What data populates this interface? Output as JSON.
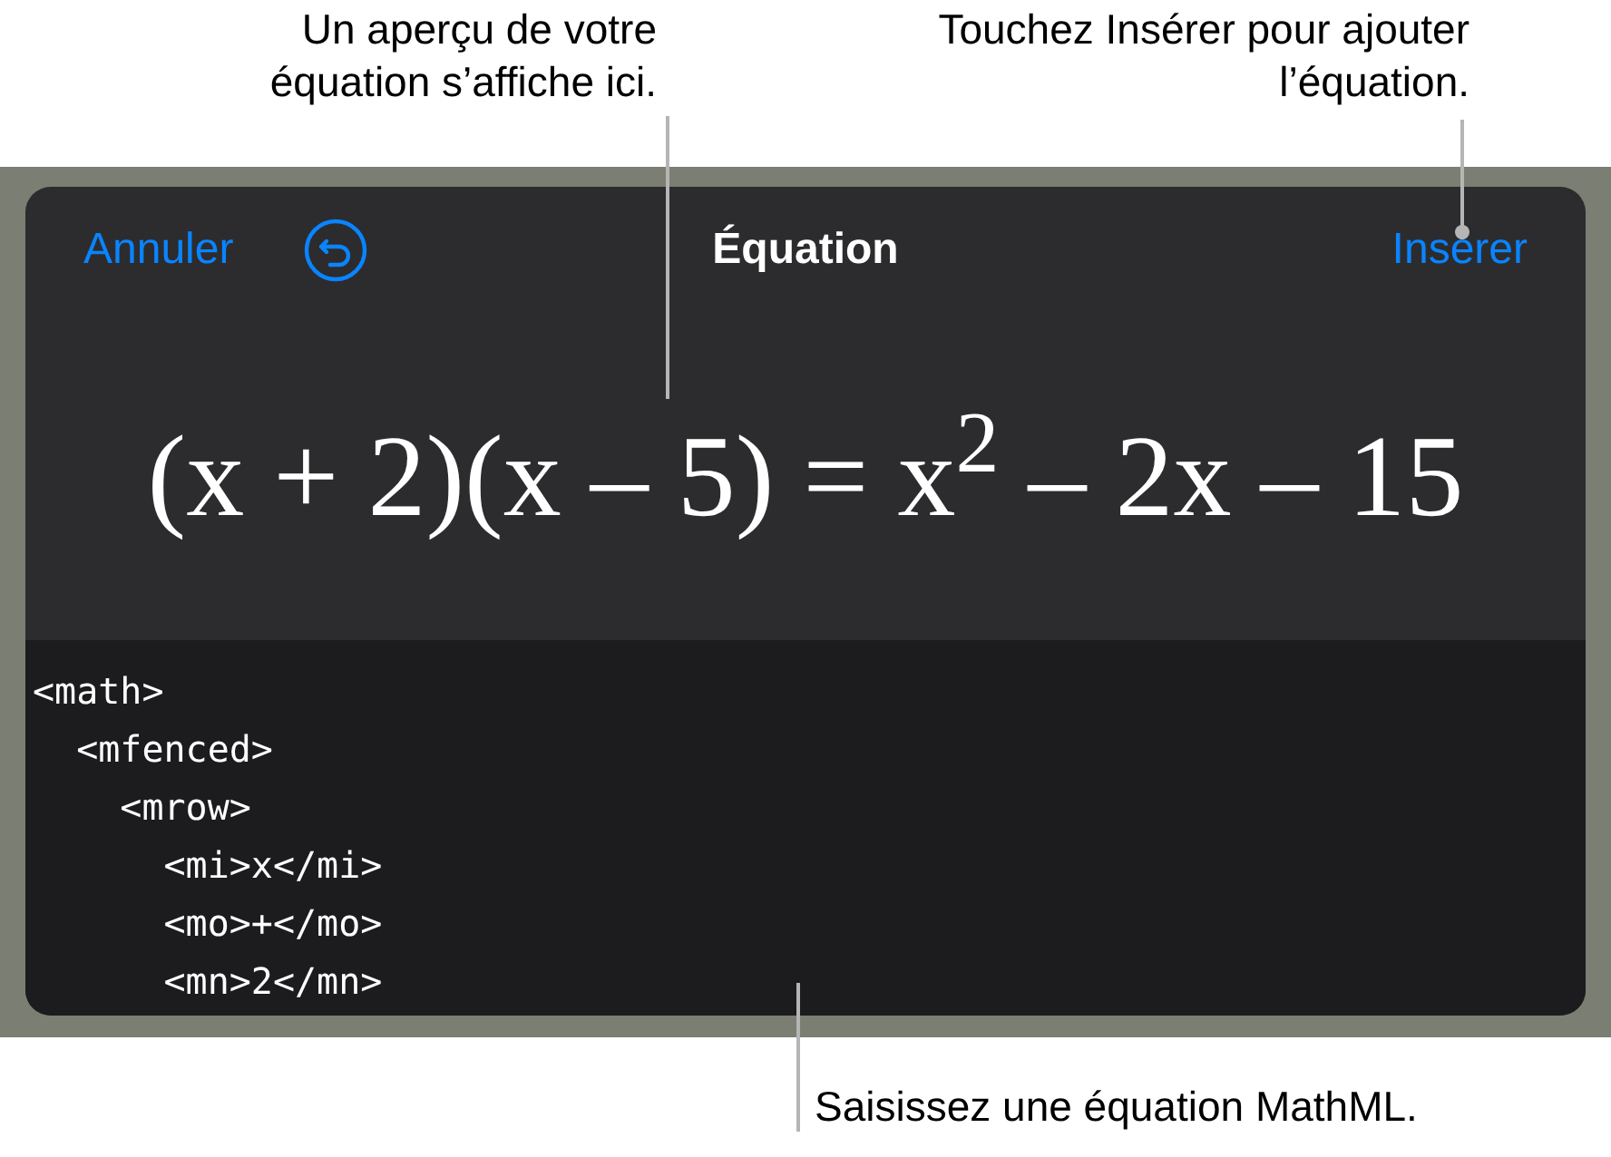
{
  "callouts": [
    {
      "text": "Un aperçu de votre équation s’affiche ici."
    },
    {
      "text": "Touchez Insérer pour ajouter l’équation."
    },
    {
      "text": "Saisissez une équation MathML."
    }
  ],
  "header": {
    "cancel": "Annuler",
    "title": "Équation",
    "insert": "Insérer"
  },
  "equation": "(x + 2)(x – 5) = x$^{2}$ – 2x – 15",
  "code_lines": [
    "<math>",
    "  <mfenced>",
    "    <mrow>",
    "      <mi>x</mi>",
    "      <mo>+</mo>",
    "      <mn>2</mn>"
  ]
}
